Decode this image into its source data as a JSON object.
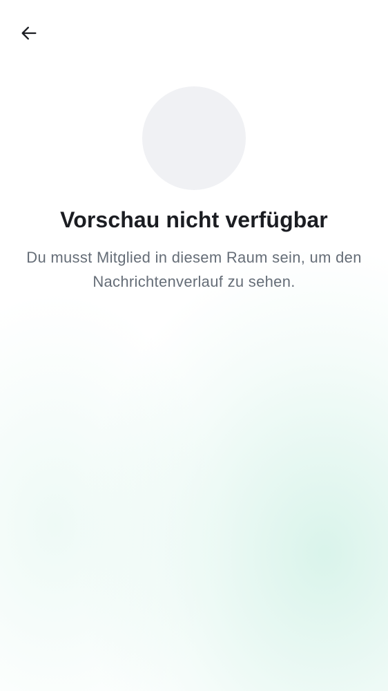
{
  "toolbar": {
    "back_icon": "arrow-left-icon"
  },
  "room": {
    "avatar_color": "#f0f1f4"
  },
  "preview": {
    "title": "Vorschau nicht verfügbar",
    "message": "Du musst Mitglied in diesem Raum sein, um den Nachrichtenverlauf zu sehen."
  },
  "colors": {
    "title": "#1b1d22",
    "message": "#656d77",
    "accent_gradient": "#cdf0e4"
  }
}
